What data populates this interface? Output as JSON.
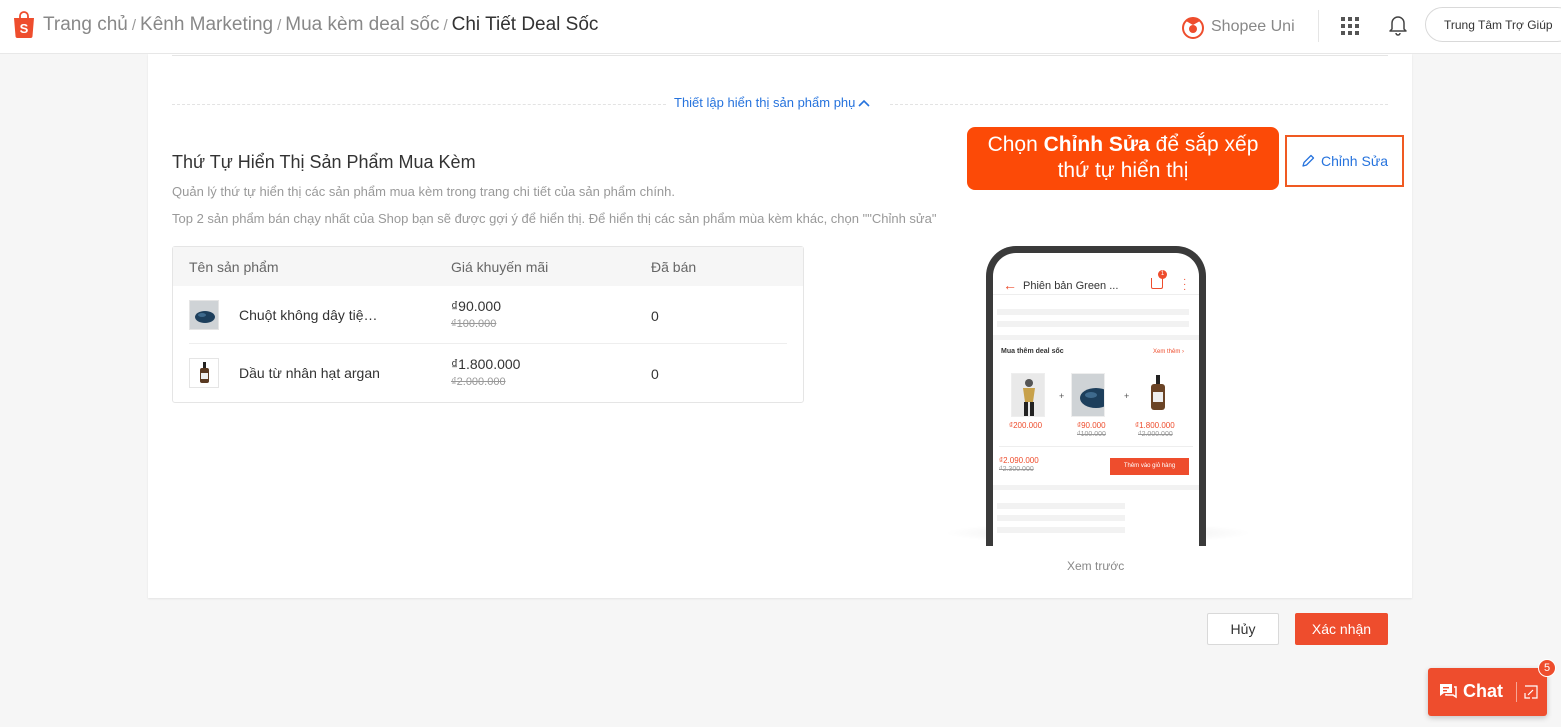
{
  "breadcrumb": {
    "items": [
      "Trang chủ",
      "Kênh Marketing",
      "Mua kèm deal sốc"
    ],
    "current": "Chi Tiết Deal Sốc",
    "separator": "/"
  },
  "header": {
    "uni_label": "Shopee Uni",
    "help_label": "Trung Tâm Trợ Giúp"
  },
  "section": {
    "toggle_label": "Thiết lập hiển thị sản phẩm phụ",
    "title": "Thứ Tự Hiển Thị Sản Phẩm Mua Kèm",
    "desc1": "Quản lý thứ tự hiển thị các sản phẩm mua kèm trong trang chi tiết của sản phẩm chính.",
    "desc2": "Top 2 sản phẩm bán chạy nhất của Shop bạn sẽ được gợi ý để hiển thị. Để hiển thị các sản phẩm mùa kèm khác, chọn \"\"Chỉnh sửa\"",
    "edit_label": "Chỉnh Sửa"
  },
  "tooltip": {
    "line1_prefix": "Chọn ",
    "line1_bold": "Chỉnh Sửa",
    "line1_suffix": " để sắp xếp",
    "line2": "thứ tự hiển thị"
  },
  "table": {
    "headers": [
      "Tên sản phẩm",
      "Giá khuyến mãi",
      "Đã bán"
    ],
    "rows": [
      {
        "name": "Chuột không dây tiện lợi",
        "price": "₫90.000",
        "original": "₫100.000",
        "sold": "0"
      },
      {
        "name": "Dầu từ nhân hạt argan",
        "price": "₫1.800.000",
        "original": "₫2.000.000",
        "sold": "0"
      }
    ]
  },
  "preview": {
    "label": "Xem trước",
    "title": "Phiên bản Green ...",
    "cart_count": "1",
    "deal_title": "Mua thêm deal sốc",
    "deal_more": "Xem thêm",
    "items": [
      {
        "price": "₫200.000",
        "original": ""
      },
      {
        "price": "₫90.000",
        "original": "₫100.000"
      },
      {
        "price": "₫1.800.000",
        "original": "₫2.000.000"
      }
    ],
    "total_price": "₫2.090.000",
    "total_original": "₫2.300.000",
    "add_to_cart": "Thêm vào giỏ hàng"
  },
  "footer": {
    "cancel_label": "Hủy",
    "confirm_label": "Xác nhận"
  },
  "chat": {
    "label": "Chat",
    "badge": "5"
  },
  "colors": {
    "brand": "#ee4d2d",
    "link": "#2673dd",
    "tooltip": "#fc4a07"
  }
}
